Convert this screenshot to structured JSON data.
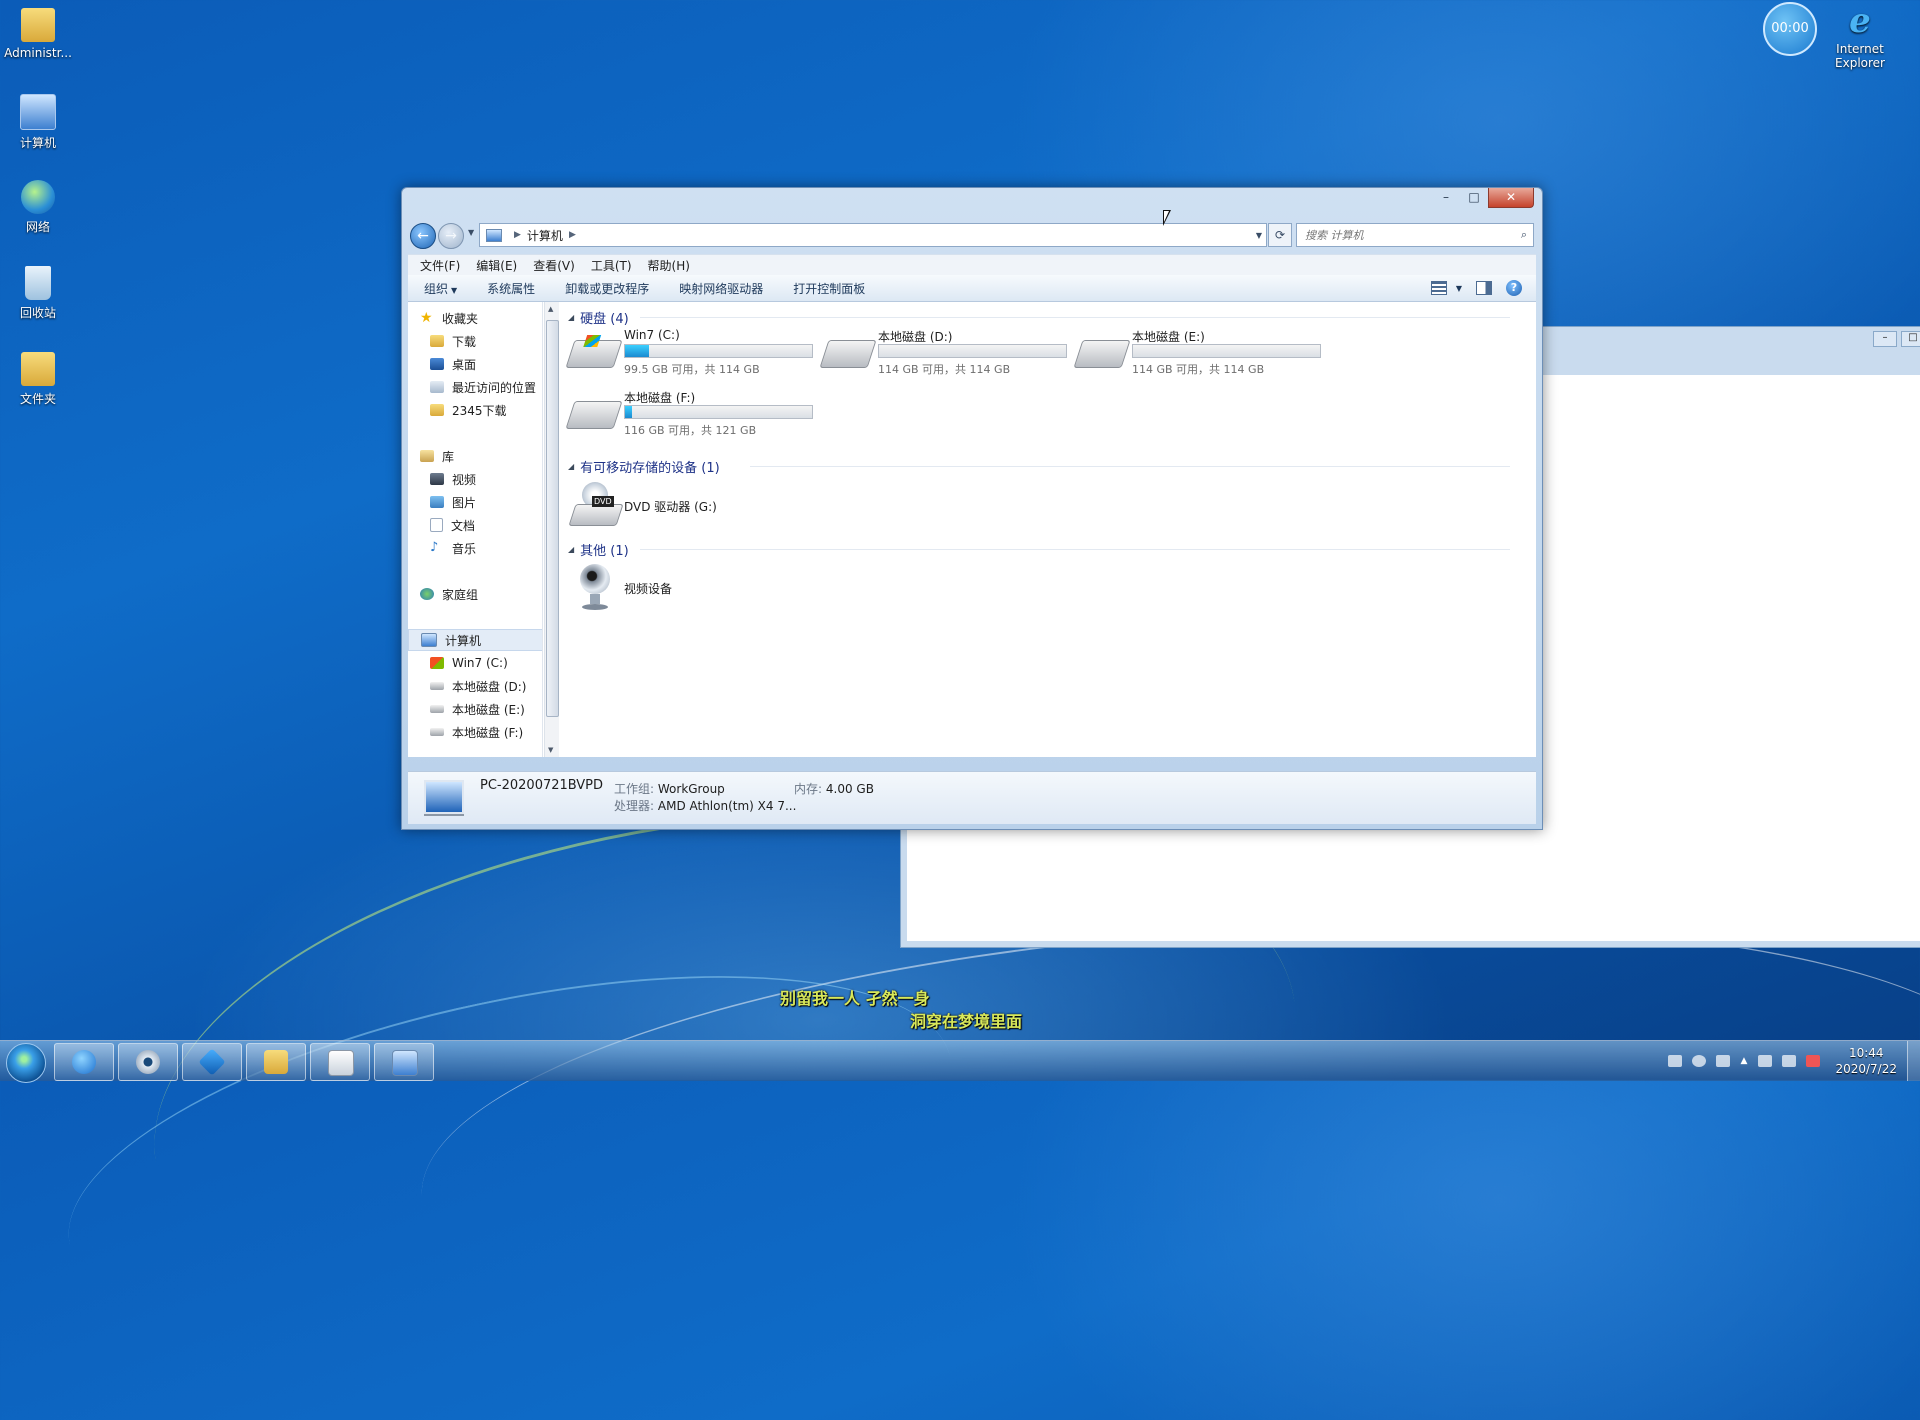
{
  "desktop": {
    "icons": [
      {
        "label": "Administr...",
        "icon": "user-folder-icon"
      },
      {
        "label": "计算机",
        "icon": "computer-icon"
      },
      {
        "label": "网络",
        "icon": "network-icon"
      },
      {
        "label": "回收站",
        "icon": "recycle-bin-icon"
      },
      {
        "label": "文件夹",
        "icon": "folder-icon"
      }
    ],
    "ie_label_1": "Internet",
    "ie_label_2": "Explorer",
    "timer": "00:00"
  },
  "window": {
    "address": {
      "crumb": "计算机"
    },
    "search": {
      "placeholder": "搜索 计算机"
    },
    "menu": [
      "文件(F)",
      "编辑(E)",
      "查看(V)",
      "工具(T)",
      "帮助(H)"
    ],
    "commands": [
      "组织",
      "系统属性",
      "卸载或更改程序",
      "映射网络驱动器",
      "打开控制面板"
    ],
    "nav": {
      "favorites": "收藏夹",
      "downloads": "下载",
      "desktop": "桌面",
      "recent": "最近访问的位置",
      "dl2345": "2345下载",
      "libraries": "库",
      "videos": "视频",
      "pictures": "图片",
      "documents": "文档",
      "music": "音乐",
      "homegroup": "家庭组",
      "computer": "计算机",
      "drive_c": "Win7 (C:)",
      "drive_d": "本地磁盘 (D:)",
      "drive_e": "本地磁盘 (E:)",
      "drive_f": "本地磁盘 (F:)"
    },
    "groups": {
      "hdd": "硬盘 (4)",
      "removable": "有可移动存储的设备 (1)",
      "other": "其他 (1)"
    },
    "drives": [
      {
        "name": "Win7 (C:)",
        "free": "99.5 GB 可用，共 114 GB",
        "used_fraction": 0.13
      },
      {
        "name": "本地磁盘 (D:)",
        "free": "114 GB 可用，共 114 GB",
        "used_fraction": 0.0
      },
      {
        "name": "本地磁盘 (E:)",
        "free": "114 GB 可用，共 114 GB",
        "used_fraction": 0.0
      },
      {
        "name": "本地磁盘 (F:)",
        "free": "116 GB 可用，共 121 GB",
        "used_fraction": 0.04
      }
    ],
    "dvd": "DVD 驱动器 (G:)",
    "dvd_badge": "DVD",
    "camera": "视频设备",
    "details": {
      "pc_name": "PC-20200721BVPD",
      "workgroup_key": "工作组:",
      "workgroup": "WorkGroup",
      "memory_key": "内存:",
      "memory": "4.00 GB",
      "cpu_key": "处理器:",
      "cpu": "AMD Athlon(tm) X4 7..."
    }
  },
  "subtitles": {
    "line1": "别留我一人 孑然一身",
    "line2": "洞穿在梦境里面"
  },
  "taskbar": {
    "time": "10:44",
    "date": "2020/7/22"
  }
}
